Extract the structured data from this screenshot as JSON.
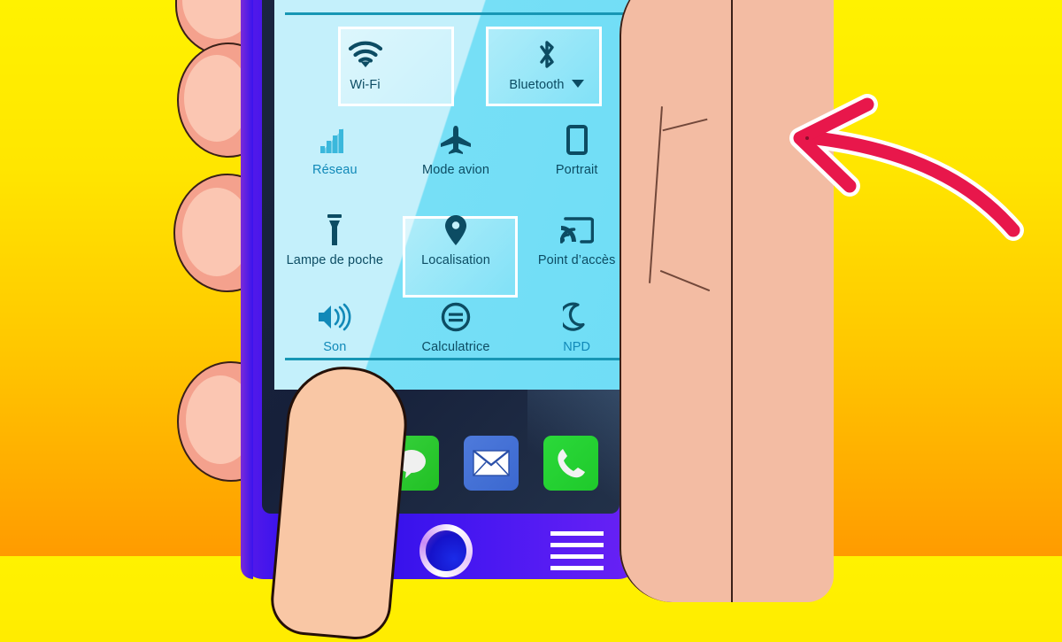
{
  "scene": {
    "background_top_color": "#FFF200",
    "background_bottom_color": "#FF9B00",
    "phone_body_color": "#3A13EE",
    "panel_color": "#C4F0FB",
    "panel_shade_color": "#6FDDF6",
    "icon_color": "#0C4C63",
    "dim_icon_color": "#1189B8",
    "arrow_color": "#E8174B",
    "arrow_outline_color": "#FFFFFF",
    "skin_color": "#F4A18D",
    "palm_color": "#F3BCA3"
  },
  "panel": {
    "tiles": [
      {
        "id": "wifi",
        "label": "Wi-Fi",
        "icon": "wifi-icon",
        "highlighted": true,
        "dimmed": false,
        "has_chevron": false
      },
      {
        "id": "bluetooth",
        "label": "Bluetooth",
        "icon": "bluetooth-icon",
        "highlighted": true,
        "dimmed": false,
        "has_chevron": true
      },
      {
        "id": "reseau",
        "label": "Réseau",
        "icon": "signal-bars-icon",
        "highlighted": false,
        "dimmed": true,
        "has_chevron": false
      },
      {
        "id": "mode-avion",
        "label": "Mode avion",
        "icon": "airplane-icon",
        "highlighted": false,
        "dimmed": false,
        "has_chevron": false
      },
      {
        "id": "portrait",
        "label": "Portrait",
        "icon": "phone-rotate-icon",
        "highlighted": false,
        "dimmed": false,
        "has_chevron": false
      },
      {
        "id": "lampe",
        "label": "Lampe de poche",
        "icon": "flashlight-icon",
        "highlighted": false,
        "dimmed": false,
        "has_chevron": false
      },
      {
        "id": "localisation",
        "label": "Localisation",
        "icon": "map-pin-icon",
        "highlighted": true,
        "dimmed": false,
        "has_chevron": false
      },
      {
        "id": "point-acces",
        "label": "Point d’accès",
        "icon": "cast-icon",
        "highlighted": false,
        "dimmed": false,
        "has_chevron": false
      },
      {
        "id": "son",
        "label": "Son",
        "icon": "speaker-icon",
        "highlighted": false,
        "dimmed": true,
        "has_chevron": false
      },
      {
        "id": "calculatrice",
        "label": "Calculatrice",
        "icon": "calculator-icon",
        "highlighted": false,
        "dimmed": false,
        "has_chevron": false
      },
      {
        "id": "npd",
        "label": "NPD",
        "icon": "moon-icon",
        "highlighted": false,
        "dimmed": true,
        "has_chevron": false
      }
    ]
  },
  "dock": {
    "apps": [
      {
        "id": "messages",
        "icon": "chat-bubble-icon",
        "color": "#2BC92F"
      },
      {
        "id": "mail",
        "icon": "envelope-icon",
        "color": "#3B68D0"
      },
      {
        "id": "phone",
        "icon": "phone-handset-icon",
        "color": "#1FC92B"
      }
    ]
  },
  "nav": {
    "home_button": "home-button",
    "menu_button": "menu-button"
  },
  "annotation": {
    "arrow": "curved-left-arrow",
    "direction": "left"
  }
}
